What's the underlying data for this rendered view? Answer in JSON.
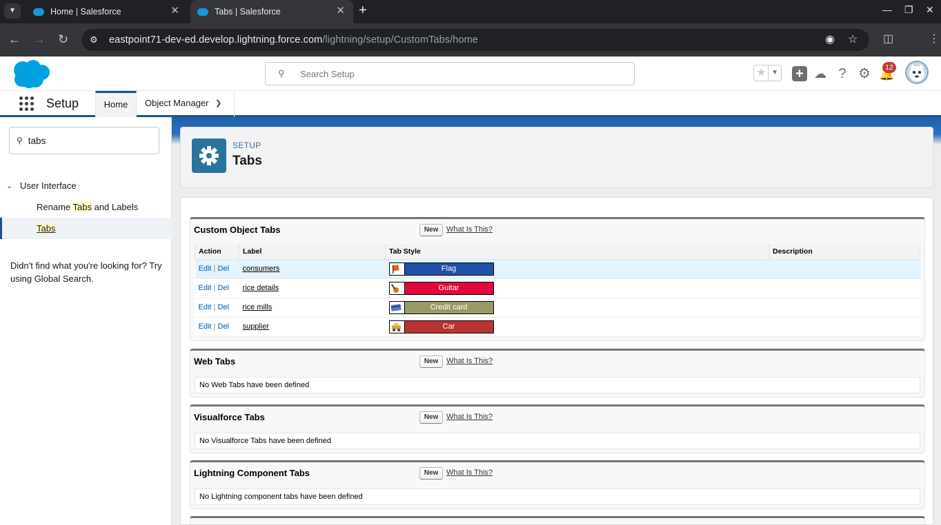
{
  "browser": {
    "tabs": [
      {
        "title": "Home | Salesforce"
      },
      {
        "title": "Tabs | Salesforce"
      }
    ],
    "url_host": "eastpoint71-dev-ed.develop.lightning.force.com",
    "url_path": "/lightning/setup/CustomTabs/home"
  },
  "header": {
    "search_placeholder": "Search Setup",
    "notification_count": "12"
  },
  "nav": {
    "app_name": "Setup",
    "home": "Home",
    "object_manager": "Object Manager"
  },
  "sidebar": {
    "quickfind_value": "tabs",
    "section": "User Interface",
    "item1_pre": "Rename ",
    "item1_mark": "Tabs",
    "item1_post": " and Labels",
    "item2": "Tabs",
    "help_text": "Didn't find what you're looking for? Try using Global Search."
  },
  "page": {
    "breadcrumb": "SETUP",
    "title": "Tabs"
  },
  "custom_object_tabs": {
    "heading": "Custom Object Tabs",
    "new_label": "New",
    "what_is_this": "What Is This?",
    "columns": [
      "Action",
      "Label",
      "Tab Style",
      "Description"
    ],
    "rows": [
      {
        "edit": "Edit",
        "del": "Del",
        "label": "consumers",
        "style": "Flag",
        "color": "#2150a8",
        "description": ""
      },
      {
        "edit": "Edit",
        "del": "Del",
        "label": "rice details",
        "style": "Guitar",
        "color": "#e0093f",
        "description": ""
      },
      {
        "edit": "Edit",
        "del": "Del",
        "label": "rice mills",
        "style": "Credit card",
        "color": "#9a9a66",
        "description": ""
      },
      {
        "edit": "Edit",
        "del": "Del",
        "label": "supplier",
        "style": "Car",
        "color": "#bb3233",
        "description": ""
      }
    ]
  },
  "web_tabs": {
    "heading": "Web Tabs",
    "new_label": "New",
    "what_is_this": "What Is This?",
    "empty": "No Web Tabs have been defined"
  },
  "visualforce_tabs": {
    "heading": "Visualforce Tabs",
    "new_label": "New",
    "what_is_this": "What Is This?",
    "empty": "No Visualforce Tabs have been defined"
  },
  "lightning_tabs": {
    "heading": "Lightning Component Tabs",
    "new_label": "New",
    "what_is_this": "What Is This?",
    "empty": "No Lightning component tabs have been defined"
  }
}
